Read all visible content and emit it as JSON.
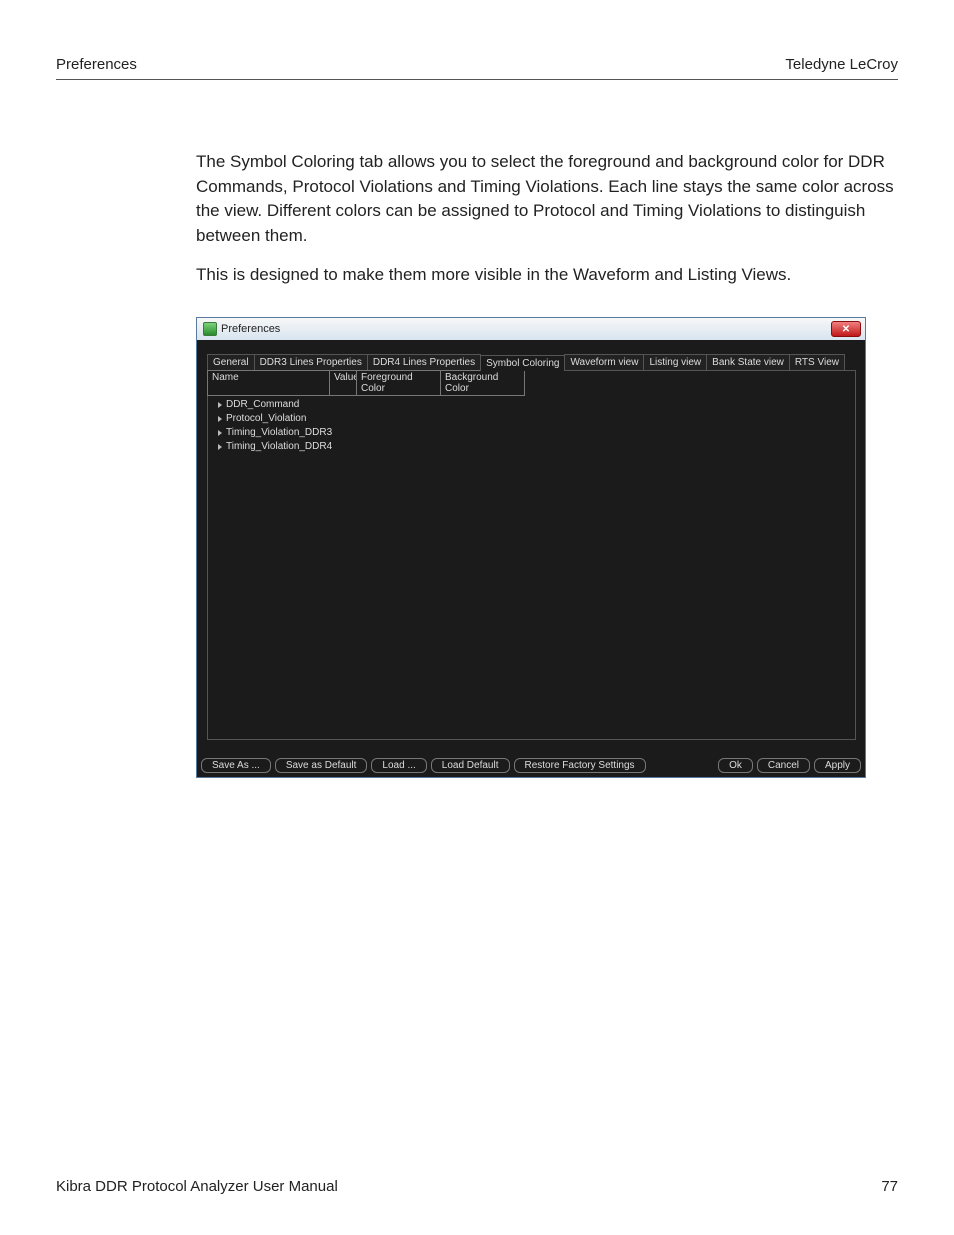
{
  "header": {
    "left": "Preferences",
    "right": "Teledyne LeCroy"
  },
  "body": {
    "p1": "The Symbol Coloring tab allows you to select the foreground and background color for DDR Commands, Protocol Violations and Timing Violations. Each line stays the same color across the view. Different colors can be assigned to Protocol and Timing Violations to distinguish between them.",
    "p2": "This is designed to make them more visible in the Waveform and Listing Views."
  },
  "dialog": {
    "title": "Preferences",
    "tabs": [
      "General",
      "DDR3 Lines Properties",
      "DDR4 Lines Properties",
      "Symbol Coloring",
      "Waveform view",
      "Listing view",
      "Bank State view",
      "RTS View"
    ],
    "active_tab_index": 3,
    "columns": {
      "name": "Name",
      "value": "Value",
      "fg": "Foreground Color",
      "bg": "Background Color"
    },
    "tree": [
      "DDR_Command",
      "Protocol_Violation",
      "Timing_Violation_DDR3",
      "Timing_Violation_DDR4"
    ],
    "buttons": {
      "save_as": "Save As ...",
      "save_default": "Save as Default",
      "load": "Load ...",
      "load_default": "Load Default",
      "restore": "Restore Factory Settings",
      "ok": "Ok",
      "cancel": "Cancel",
      "apply": "Apply"
    }
  },
  "footer": {
    "left": "Kibra DDR Protocol Analyzer User Manual",
    "page": "77"
  }
}
